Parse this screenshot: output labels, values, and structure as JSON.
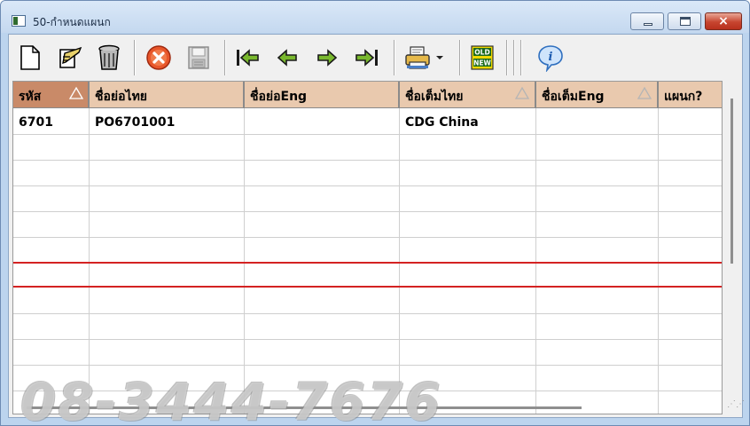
{
  "window": {
    "title": "50-กำหนดแผนก",
    "close_glyph": "×"
  },
  "toolbar": {
    "buttons": [
      {
        "name": "new-icon"
      },
      {
        "name": "edit-icon"
      },
      {
        "name": "delete-trash-icon"
      },
      {
        "name": "cancel-icon"
      },
      {
        "name": "save-disk-icon"
      },
      {
        "name": "first-record-icon"
      },
      {
        "name": "previous-record-icon"
      },
      {
        "name": "next-record-icon"
      },
      {
        "name": "last-record-icon"
      },
      {
        "name": "print-icon"
      },
      {
        "name": "dropdown-arrow-icon"
      },
      {
        "name": "old-new-icon",
        "label_top": "OLD",
        "label_bottom": "NEW"
      },
      {
        "name": "info-icon",
        "glyph": "i"
      }
    ]
  },
  "grid": {
    "columns": [
      {
        "label": "รหัส"
      },
      {
        "label": "ชื่อย่อไทย"
      },
      {
        "label": "ชื่อย่อEng"
      },
      {
        "label": "ชื่อเต็มไทย"
      },
      {
        "label": "ชื่อเต็มEng"
      },
      {
        "label": "แผนก?"
      }
    ],
    "rows": [
      {
        "code": "6701",
        "short_thai": "PO6701001",
        "short_eng": "",
        "full_thai": "CDG China",
        "full_eng": "",
        "department": ""
      }
    ],
    "highlight_color": "#d42222"
  },
  "watermark": "08-3444-7676"
}
